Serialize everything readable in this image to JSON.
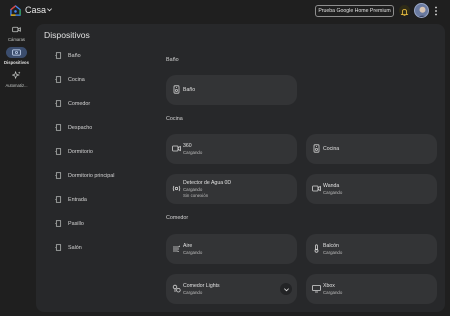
{
  "header": {
    "home_name": "Casa",
    "premium_label": "Prueba Google Home Premium"
  },
  "rail": {
    "items": [
      {
        "label": "Cámaras"
      },
      {
        "label": "Dispositivos"
      },
      {
        "label": "Automatiz..."
      }
    ]
  },
  "panel": {
    "title": "Dispositivos",
    "rooms": [
      "Baño",
      "Cocina",
      "Comedor",
      "Despacho",
      "Dormitorio",
      "Dormitorio principal",
      "Entrada",
      "Pasillo",
      "Salón"
    ]
  },
  "sections": [
    {
      "title": "Baño"
    },
    {
      "title": "Cocina"
    },
    {
      "title": "Comedor"
    }
  ],
  "cards": [
    {
      "name": "Baño",
      "status": "",
      "status2": "",
      "icon": "speaker-icon"
    },
    {
      "name": "360",
      "status": "Cargando",
      "status2": "",
      "icon": "camera-icon"
    },
    {
      "name": "Cocina",
      "status": "",
      "status2": "",
      "icon": "speaker-icon"
    },
    {
      "name": "Detector de Agua 0D",
      "status": "Cargando",
      "status2": "Sin conexión",
      "icon": "sensor-icon"
    },
    {
      "name": "Wanda",
      "status": "Cargando",
      "status2": "",
      "icon": "camera-icon"
    },
    {
      "name": "Aire",
      "status": "Cargando",
      "status2": "",
      "icon": "air-icon"
    },
    {
      "name": "Balcón",
      "status": "Cargando",
      "status2": "",
      "icon": "thermometer-icon"
    },
    {
      "name": "Comedor Lights",
      "status": "Cargando",
      "status2": "",
      "icon": "lights-icon"
    },
    {
      "name": "Xbox",
      "status": "Cargando",
      "status2": "",
      "icon": "tv-icon"
    }
  ],
  "colors": {
    "background": "#1f1f1f",
    "panel": "#27282a",
    "card": "#333436",
    "active_pill": "#3b4d6d",
    "accent_blue": "#8ab4f8"
  }
}
